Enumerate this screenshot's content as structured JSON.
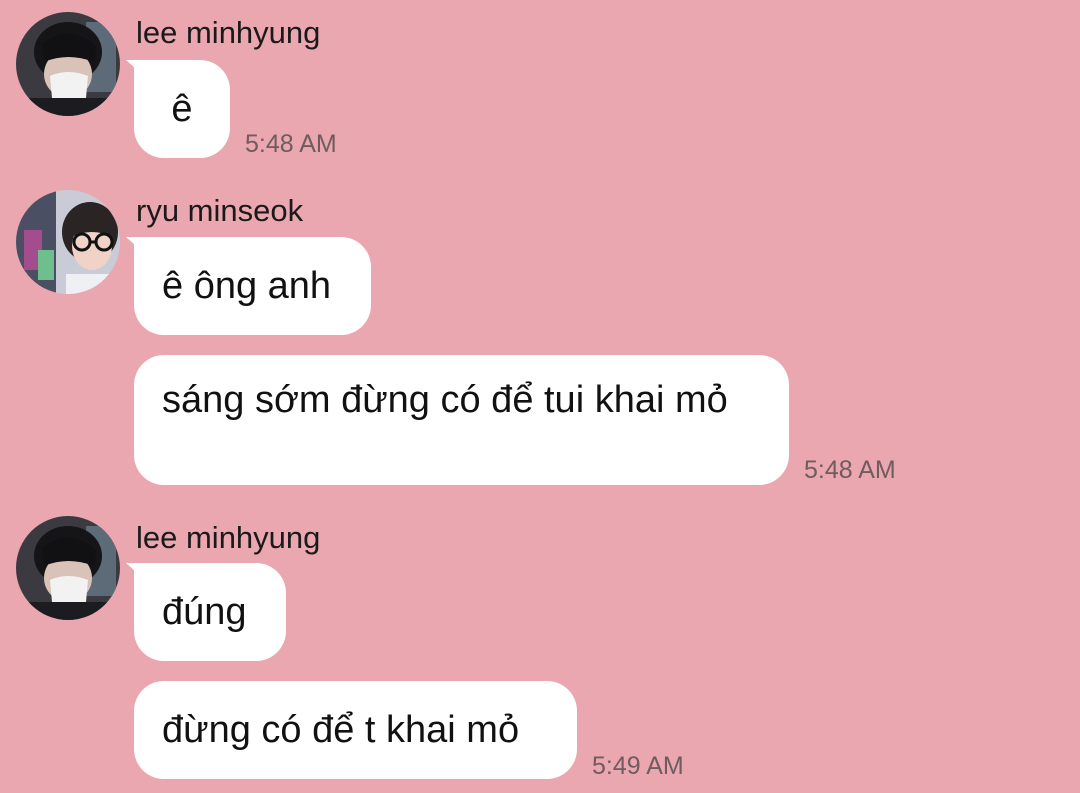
{
  "chat": {
    "groups": [
      {
        "sender": "lee minhyung",
        "messages": [
          {
            "text": "ê",
            "time": "5:48 AM"
          }
        ]
      },
      {
        "sender": "ryu minseok",
        "messages": [
          {
            "text": "ê ông anh"
          },
          {
            "text": "sáng sớm đừng có để tui khai mỏ",
            "time": "5:48 AM"
          }
        ]
      },
      {
        "sender": "lee minhyung",
        "messages": [
          {
            "text": "đúng"
          },
          {
            "text": "đừng có để t khai mỏ",
            "time": "5:49 AM"
          }
        ]
      }
    ]
  },
  "colors": {
    "background": "#EBA7B0",
    "bubble": "#FFFFFF",
    "time_text": "#6f5b60"
  },
  "icons": {
    "avatar_minhyung": "avatar-masked-person",
    "avatar_minseok": "avatar-glasses-person"
  }
}
